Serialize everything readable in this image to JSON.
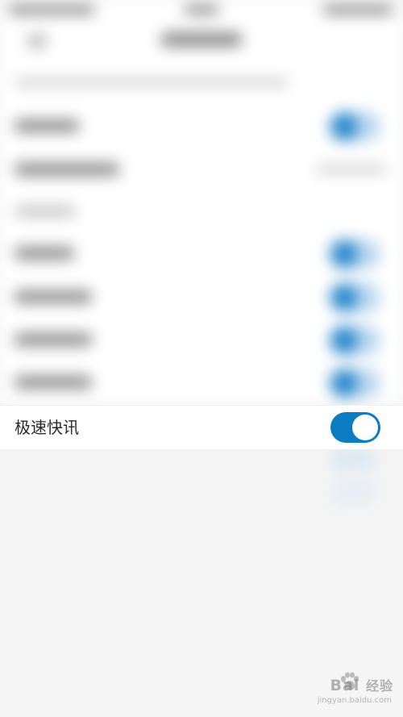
{
  "setting_row": {
    "label": "极速快讯",
    "enabled": true
  },
  "colors": {
    "accent": "#0b7cc1",
    "background": "#f5f5f5",
    "row_background": "#ffffff"
  },
  "watermark": {
    "main": "Bai",
    "main_cn": "经验",
    "sub": "jingyan.baidu.com"
  }
}
